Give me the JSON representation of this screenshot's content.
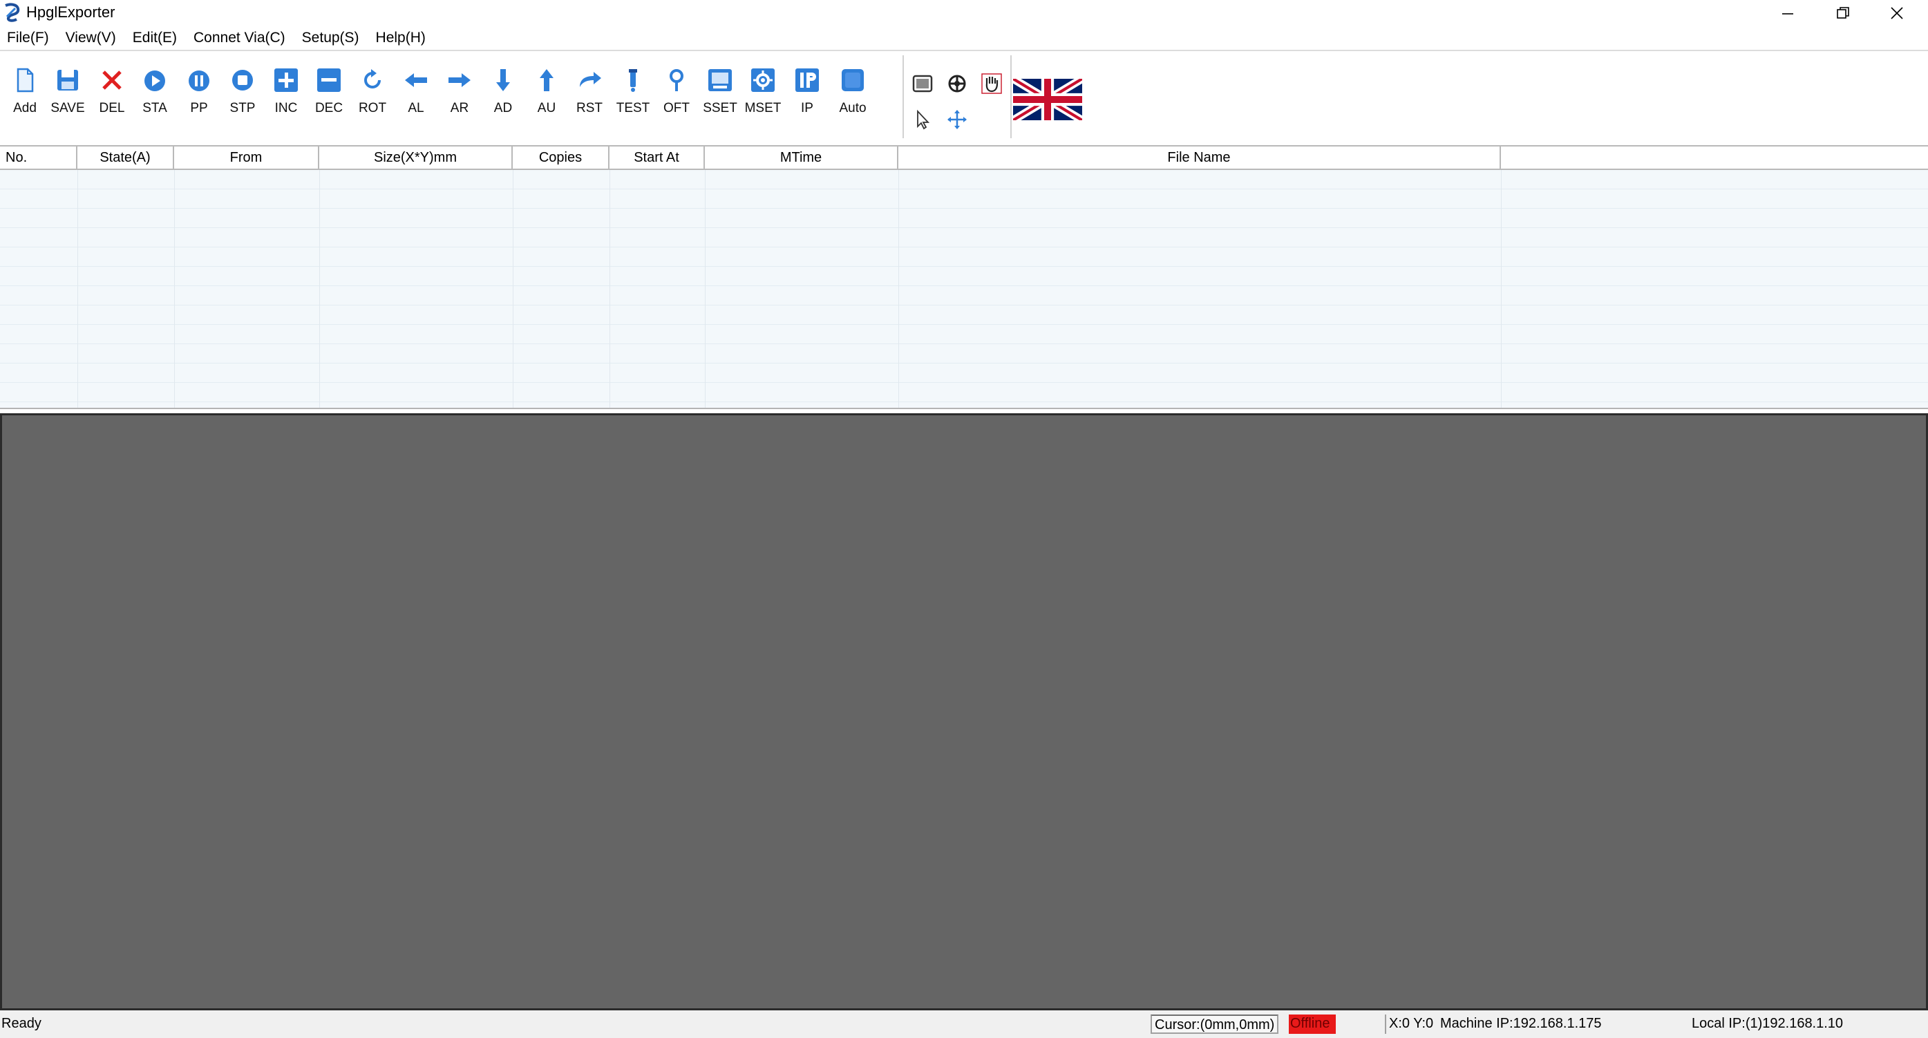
{
  "window": {
    "title": "HpglExporter",
    "minimize_icon": "minimize-icon",
    "restore_icon": "restore-icon",
    "close_icon": "close-icon"
  },
  "menu": [
    {
      "label": "File(F)"
    },
    {
      "label": "View(V)"
    },
    {
      "label": "Edit(E)"
    },
    {
      "label": "Connet Via(C)"
    },
    {
      "label": "Setup(S)"
    },
    {
      "label": "Help(H)"
    }
  ],
  "toolbar": {
    "tools": [
      {
        "label": "Add",
        "icon": "new-file-icon"
      },
      {
        "label": "SAVE",
        "icon": "save-icon"
      },
      {
        "label": "DEL",
        "icon": "delete-icon"
      },
      {
        "label": "STA",
        "icon": "play-icon"
      },
      {
        "label": "PP",
        "icon": "pause-icon"
      },
      {
        "label": "STP",
        "icon": "stop-icon"
      },
      {
        "label": "INC",
        "icon": "plus-icon"
      },
      {
        "label": "DEC",
        "icon": "minus-icon"
      },
      {
        "label": "ROT",
        "icon": "rotate-icon"
      },
      {
        "label": "AL",
        "icon": "arrow-left-icon"
      },
      {
        "label": "AR",
        "icon": "arrow-right-icon"
      },
      {
        "label": "AD",
        "icon": "arrow-down-icon"
      },
      {
        "label": "AU",
        "icon": "arrow-up-icon"
      },
      {
        "label": "RST",
        "icon": "reset-icon"
      },
      {
        "label": "TEST",
        "icon": "test-icon"
      },
      {
        "label": "OFT",
        "icon": "offset-pin-icon"
      },
      {
        "label": "SSET",
        "icon": "system-settings-icon"
      },
      {
        "label": "MSET",
        "icon": "machine-settings-icon"
      },
      {
        "label": "IP",
        "icon": "ip-icon"
      },
      {
        "label": "Auto",
        "icon": "auto-icon"
      }
    ],
    "view_tools": [
      "fit-window-icon",
      "zoom-target-icon",
      "hand-pan-icon",
      "pointer-select-icon",
      "move-cross-icon"
    ],
    "language_icon": "uk-flag-icon"
  },
  "table": {
    "columns": [
      "No.",
      "State(A)",
      "From",
      "Size(X*Y)mm",
      "Copies",
      "Start At",
      "MTime",
      "File Name"
    ],
    "rows": []
  },
  "status": {
    "ready": "Ready",
    "cursor": "Cursor:(0mm,0mm)",
    "connection": "Offline",
    "xy": "X:0 Y:0",
    "machine_ip": "Machine IP:192.168.1.175",
    "local_ip": "Local IP:(1)192.168.1.10"
  },
  "colors": {
    "toolbar_icon_blue": "#2f7fd8",
    "delete_red": "#e02020",
    "preview_bg": "#656565",
    "offline_bg": "#e81a1a"
  }
}
